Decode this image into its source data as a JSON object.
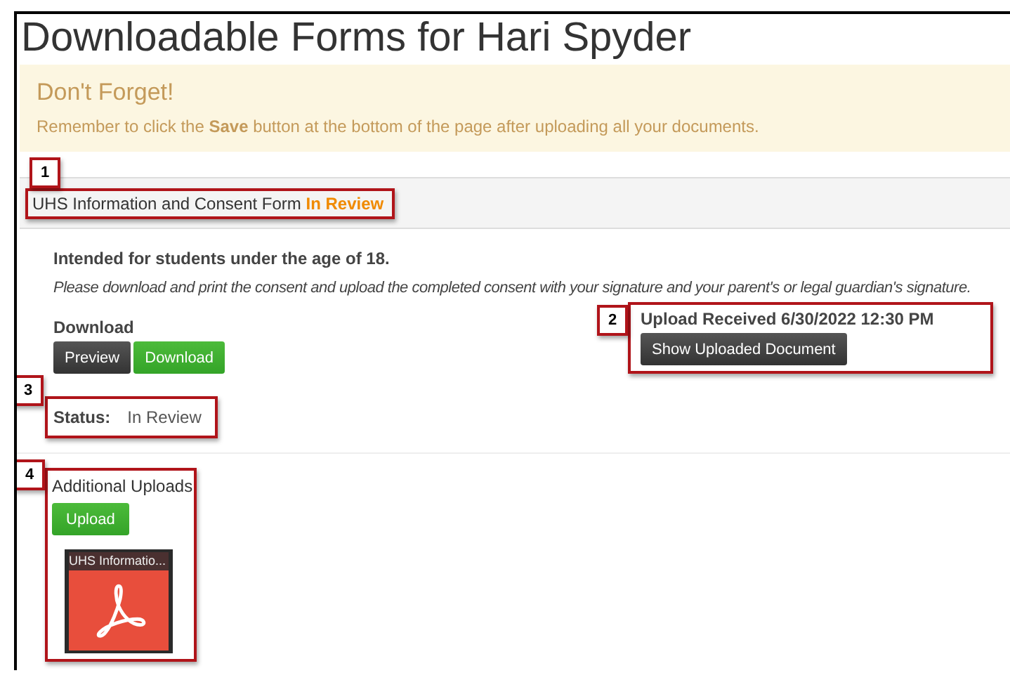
{
  "page_title": "Downloadable Forms for Hari Spyder",
  "alert": {
    "heading": "Don't Forget!",
    "message": "Remember to click the **Save** button at the bottom of the page after uploading all your documents."
  },
  "form": {
    "title": "UHS Information and Consent Form",
    "title_status": "In Review",
    "audience": "Intended for students under the age of 18.",
    "instructions": "Please download and print the consent and upload the completed consent with your signature and your parent's or legal guardian's signature.",
    "download": {
      "heading": "Download",
      "buttons": [
        {
          "label": "Preview",
          "kind": "dark"
        },
        {
          "label": "Download",
          "kind": "green"
        }
      ]
    },
    "upload": {
      "received": "Upload Received 6/30/2022 12:30 PM",
      "button": "Show Uploaded Document"
    },
    "status": {
      "label": "Status:",
      "value": "In Review"
    },
    "additional": {
      "heading": "Additional Uploads",
      "button": "Upload",
      "files": [
        {
          "name": "UHS Informatio..."
        }
      ]
    }
  },
  "callouts": [
    "1",
    "2",
    "3",
    "4"
  ]
}
